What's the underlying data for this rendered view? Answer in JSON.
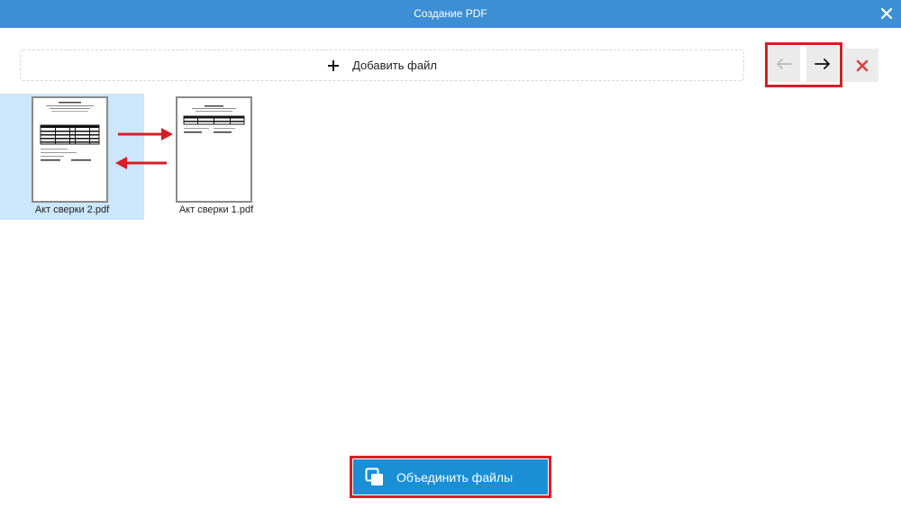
{
  "window": {
    "title": "Создание PDF"
  },
  "toolbar": {
    "add_file_label": "Добавить файл",
    "icons": {
      "add": "plus-icon",
      "prev": "arrow-left-icon",
      "next": "arrow-right-icon",
      "delete": "close-icon",
      "window_close": "close-icon"
    }
  },
  "files": [
    {
      "name": "Акт сверки 2.pdf",
      "selected": true
    },
    {
      "name": "Акт сверки 1.pdf",
      "selected": false
    }
  ],
  "footer": {
    "merge_label": "Объединить файлы",
    "merge_icon": "merge-pages-icon"
  },
  "colors": {
    "titlebar": "#3d8fd4",
    "selection": "#cce6fb",
    "primary_button": "#1a8fd6",
    "annotation": "#d81e24",
    "delete_icon": "#d9413c"
  }
}
